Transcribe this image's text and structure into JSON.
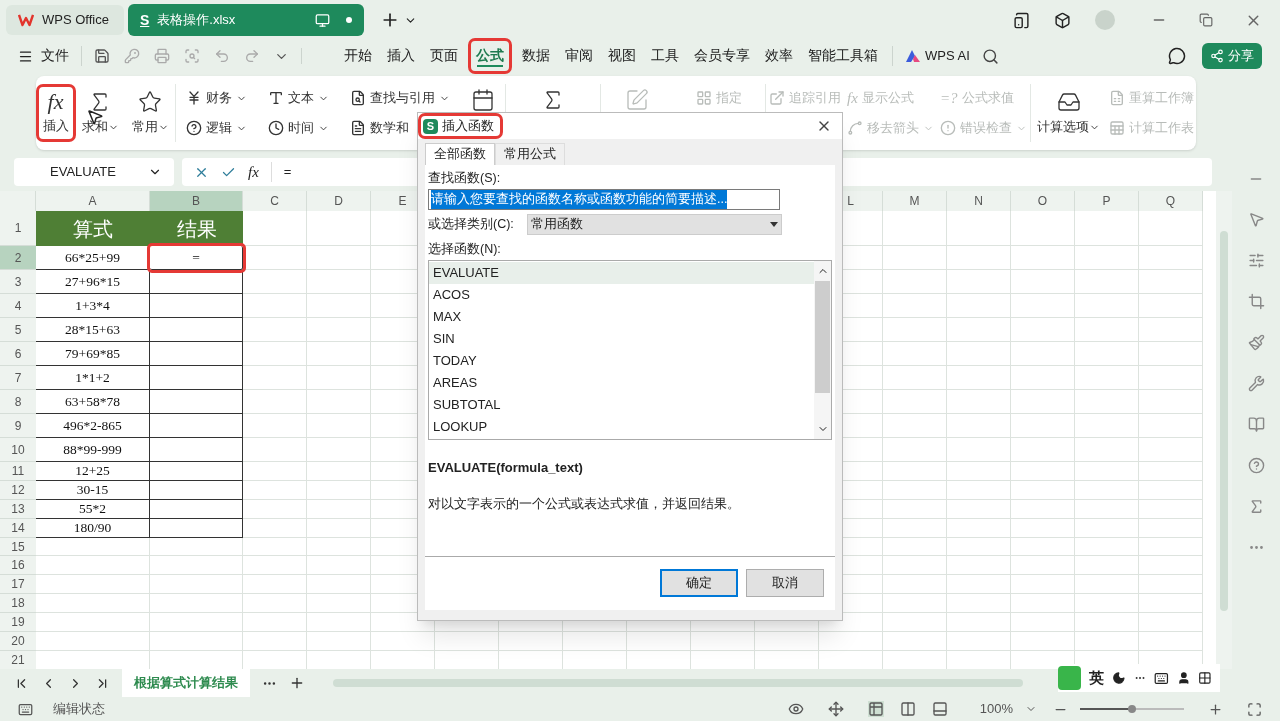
{
  "title_bar": {
    "tabs": [
      {
        "kind": "home",
        "label": "WPS Office",
        "selected": false
      },
      {
        "kind": "file",
        "badge": "S",
        "label": "表格操作.xlsx",
        "selected": true
      }
    ]
  },
  "menu_bar": {
    "file_label": "文件",
    "tabs": [
      {
        "label": "开始",
        "selected": false,
        "highlighted": false
      },
      {
        "label": "插入",
        "selected": false,
        "highlighted": false
      },
      {
        "label": "页面",
        "selected": false,
        "highlighted": false
      },
      {
        "label": "公式",
        "selected": true,
        "highlighted": true
      },
      {
        "label": "数据",
        "selected": false,
        "highlighted": false
      },
      {
        "label": "审阅",
        "selected": false,
        "highlighted": false
      },
      {
        "label": "视图",
        "selected": false,
        "highlighted": false
      },
      {
        "label": "工具",
        "selected": false,
        "highlighted": false
      },
      {
        "label": "会员专享",
        "selected": false,
        "highlighted": false
      },
      {
        "label": "效率",
        "selected": false,
        "highlighted": false
      },
      {
        "label": "智能工具箱",
        "selected": false,
        "highlighted": false
      }
    ],
    "ai_label": "WPS AI",
    "share_label": "分享"
  },
  "ribbon": {
    "groups": [
      {
        "items": [
          {
            "kind": "large",
            "glyph": "fx",
            "label": "插入",
            "caret": false,
            "disabled": false,
            "highlighted": true
          },
          {
            "kind": "large",
            "label": "求和",
            "caret": true,
            "disabled": false,
            "highlighted": false
          },
          {
            "kind": "large",
            "label": "常用",
            "caret": true,
            "disabled": false,
            "highlighted": false
          }
        ]
      },
      {
        "items": [
          {
            "kind": "pair",
            "top": {
              "label": "财务",
              "caret": true,
              "disabled": false
            },
            "bottom": {
              "label": "逻辑",
              "caret": true,
              "disabled": false
            }
          },
          {
            "kind": "pair",
            "top": {
              "label": "文本",
              "caret": true,
              "disabled": false
            },
            "bottom": {
              "label": "时间",
              "caret": true,
              "disabled": false
            }
          },
          {
            "kind": "pair",
            "top": {
              "label": "查找与引用",
              "caret": true,
              "disabled": false
            },
            "bottom": {
              "label": "数学和",
              "caret": false,
              "disabled": false
            }
          },
          {
            "kind": "icon",
            "disabled": false
          }
        ]
      },
      {
        "items": [
          {
            "kind": "icon",
            "disabled": false
          }
        ]
      },
      {
        "items": [
          {
            "kind": "icon",
            "disabled": true
          },
          {
            "kind": "pair",
            "top": {
              "label": "指定",
              "caret": false,
              "disabled": true
            }
          }
        ]
      },
      {
        "items": [
          {
            "kind": "pair",
            "top": {
              "label": "追踪引用",
              "caret": false,
              "disabled": true
            }
          },
          {
            "kind": "pair",
            "top": {
              "glyph": "fx",
              "label": "显示公式",
              "caret": false,
              "disabled": true
            },
            "bottom": {
              "label": "移去箭头",
              "caret": true,
              "disabled": true
            }
          },
          {
            "kind": "pair",
            "top": {
              "glyph": "=?",
              "label": "公式求值",
              "caret": false,
              "disabled": true
            },
            "bottom": {
              "label": "错误检查",
              "caret": true,
              "disabled": true
            }
          }
        ]
      },
      {
        "items": [
          {
            "kind": "large",
            "label": "计算选项",
            "caret": true,
            "disabled": false,
            "highlighted": false
          },
          {
            "kind": "pair",
            "top": {
              "label": "重算工作簿",
              "caret": false,
              "disabled": true
            },
            "bottom": {
              "label": "计算工作表",
              "caret": false,
              "disabled": true
            }
          }
        ]
      }
    ]
  },
  "formula_bar": {
    "name_box": "EVALUATE",
    "fx": "fx",
    "content": "="
  },
  "sheet": {
    "columns_left": [
      {
        "label": "A",
        "selected": false
      },
      {
        "label": "B",
        "selected": true
      },
      {
        "label": "C",
        "selected": false
      },
      {
        "label": "D",
        "selected": false
      },
      {
        "label": "E",
        "selected": false
      }
    ],
    "columns_right": [
      {
        "label": "L",
        "selected": false
      },
      {
        "label": "M",
        "selected": false
      },
      {
        "label": "N",
        "selected": false
      },
      {
        "label": "O",
        "selected": false
      },
      {
        "label": "P",
        "selected": false
      },
      {
        "label": "Q",
        "selected": false
      }
    ],
    "rows": [
      {
        "kind": "title",
        "number": "1",
        "a": "算式",
        "b": "结果",
        "selected": false,
        "b_highlighted": false
      },
      {
        "kind": "data",
        "number": "2",
        "a": "66*25+99",
        "b": "=",
        "selected": true,
        "b_highlighted": true
      },
      {
        "kind": "data",
        "number": "3",
        "a": "27+96*15",
        "selected": false,
        "b_highlighted": false
      },
      {
        "kind": "data",
        "number": "4",
        "a": "1+3*4",
        "selected": false,
        "b_highlighted": false
      },
      {
        "kind": "data",
        "number": "5",
        "a": "28*15+63",
        "selected": false,
        "b_highlighted": false
      },
      {
        "kind": "data",
        "number": "6",
        "a": "79+69*85",
        "selected": false,
        "b_highlighted": false
      },
      {
        "kind": "data",
        "number": "7",
        "a": "1*1+2",
        "selected": false,
        "b_highlighted": false
      },
      {
        "kind": "data",
        "number": "8",
        "a": "63+58*78",
        "selected": false,
        "b_highlighted": false
      },
      {
        "kind": "data",
        "number": "9",
        "a": "496*2-865",
        "selected": false,
        "b_highlighted": false
      },
      {
        "kind": "data",
        "number": "10",
        "a": "88*99-999",
        "selected": false,
        "b_highlighted": false
      },
      {
        "kind": "compact",
        "number": "11",
        "a": "12+25",
        "selected": false,
        "b_highlighted": false
      },
      {
        "kind": "compact",
        "number": "12",
        "a": "30-15",
        "selected": false,
        "b_highlighted": false
      },
      {
        "kind": "compact",
        "number": "13",
        "a": "55*2",
        "selected": false,
        "b_highlighted": false
      },
      {
        "kind": "compact",
        "number": "14",
        "a": "180/90",
        "selected": false,
        "b_highlighted": false
      },
      {
        "kind": "empty",
        "number": "15",
        "selected": false
      },
      {
        "kind": "empty",
        "number": "16",
        "selected": false
      },
      {
        "kind": "empty",
        "number": "17",
        "selected": false
      },
      {
        "kind": "empty",
        "number": "18",
        "selected": false
      },
      {
        "kind": "empty",
        "number": "19",
        "selected": false
      },
      {
        "kind": "empty",
        "number": "20",
        "selected": false
      },
      {
        "kind": "empty",
        "number": "21",
        "selected": false
      }
    ]
  },
  "sheet_tabs": [
    {
      "label": "根据算式计算结果",
      "selected": true
    }
  ],
  "ime": {
    "label": "英"
  },
  "status_bar": {
    "mode": "编辑状态",
    "zoom": "100%",
    "level": 0.5
  },
  "dialog": {
    "badge": "S",
    "title": "插入函数",
    "highlighted": true,
    "tabs": [
      {
        "label": "全部函数",
        "selected": true
      },
      {
        "label": "常用公式",
        "selected": false
      }
    ],
    "search_label": "查找函数(S):",
    "search_value": "请输入您要查找的函数名称或函数功能的简要描述...",
    "search_value_selected": true,
    "category_label": "或选择类别(C):",
    "category_value": "常用函数",
    "list_label": "选择函数(N):",
    "functions": [
      {
        "name": "EVALUATE",
        "selected": true
      },
      {
        "name": "ACOS",
        "selected": false
      },
      {
        "name": "MAX",
        "selected": false
      },
      {
        "name": "SIN",
        "selected": false
      },
      {
        "name": "TODAY",
        "selected": false
      },
      {
        "name": "AREAS",
        "selected": false
      },
      {
        "name": "SUBTOTAL",
        "selected": false
      },
      {
        "name": "LOOKUP",
        "selected": false
      }
    ],
    "signature": "EVALUATE(formula_text)",
    "description": "对以文字表示的一个公式或表达式求值，并返回结果。",
    "buttons": [
      {
        "label": "确定",
        "default": true
      },
      {
        "label": "取消",
        "default": false
      }
    ]
  }
}
